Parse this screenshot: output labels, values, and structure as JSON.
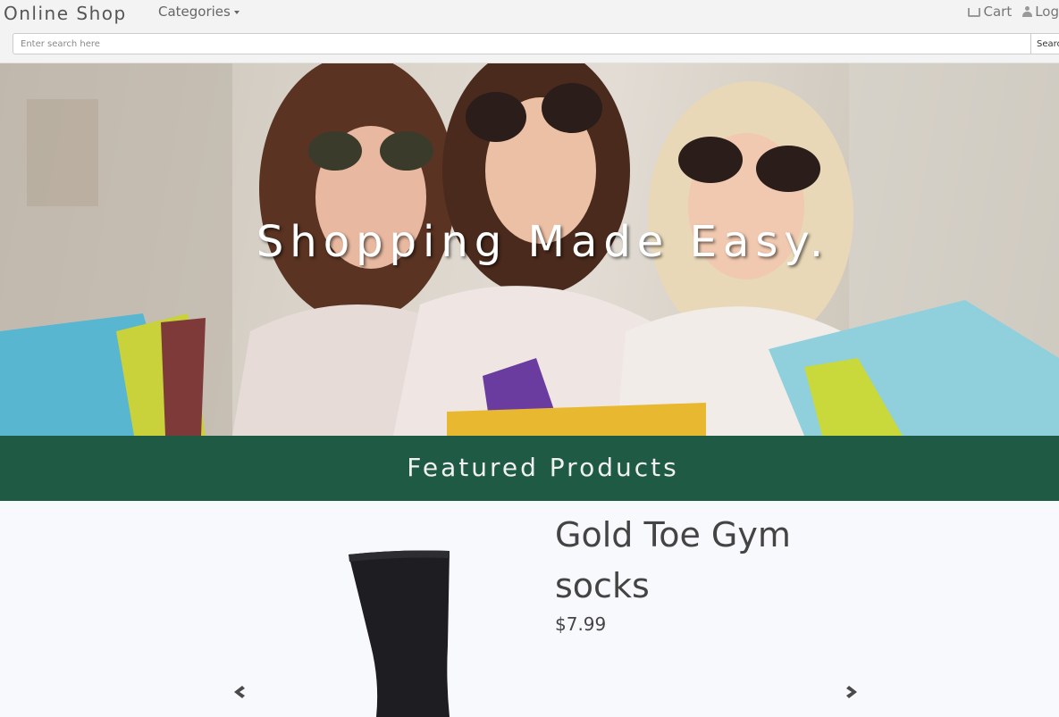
{
  "navbar": {
    "brand": "Online Shop",
    "categories_label": "Categories",
    "cart_label": "Cart",
    "login_label": "Log"
  },
  "search": {
    "placeholder": "Enter search here",
    "button_label": "Searc"
  },
  "hero": {
    "title": "Shopping Made Easy."
  },
  "featured": {
    "title": "Featured Products"
  },
  "product": {
    "name": "Gold Toe Gym socks",
    "price": "$7.99",
    "image_icon": "sock-image"
  },
  "carousel": {
    "prev_icon": "chevron-left-icon",
    "next_icon": "chevron-right-icon"
  },
  "colors": {
    "featured_bar": "#1f5a45",
    "navbar_bg": "#f3f3f3",
    "product_bg": "#f8f9fc"
  }
}
